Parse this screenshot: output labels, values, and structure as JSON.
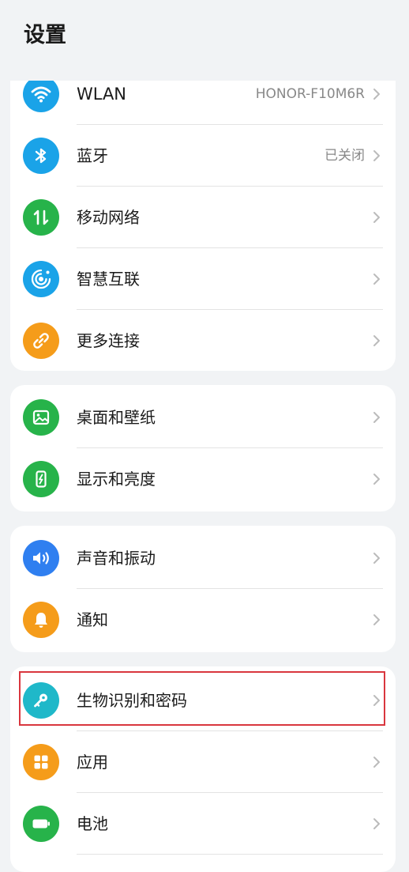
{
  "header": {
    "title": "设置"
  },
  "colors": {
    "highlight": "#d9363e",
    "wlan_icon": "#1aa3e8",
    "bluetooth_icon": "#1aa3e8",
    "mobile_icon": "#27b34a",
    "smart_icon": "#1aa3e8",
    "more_icon": "#f59c1a",
    "wallpaper_icon": "#27b34a",
    "display_icon": "#27b34a",
    "sound_icon": "#2f7ff0",
    "notify_icon": "#f59c1a",
    "biometric_icon": "#1fb8c9",
    "apps_icon": "#f59c1a",
    "battery_icon": "#27b34a"
  },
  "groups": {
    "connectivity": {
      "wlan": {
        "label": "WLAN",
        "value": "HONOR-F10M6R",
        "icon": "wifi-icon"
      },
      "bluetooth": {
        "label": "蓝牙",
        "value": "已关闭",
        "icon": "bluetooth-icon"
      },
      "mobile": {
        "label": "移动网络",
        "icon": "mobile-data-icon"
      },
      "smart": {
        "label": "智慧互联",
        "icon": "smart-connect-icon"
      },
      "more": {
        "label": "更多连接",
        "icon": "link-icon"
      }
    },
    "display": {
      "wallpaper": {
        "label": "桌面和壁纸",
        "icon": "image-icon"
      },
      "brightness": {
        "label": "显示和亮度",
        "icon": "brightness-icon"
      }
    },
    "sound": {
      "sound": {
        "label": "声音和振动",
        "icon": "speaker-icon"
      },
      "notify": {
        "label": "通知",
        "icon": "bell-icon"
      }
    },
    "security": {
      "biometric": {
        "label": "生物识别和密码",
        "icon": "key-icon"
      },
      "apps": {
        "label": "应用",
        "icon": "apps-grid-icon"
      },
      "battery": {
        "label": "电池",
        "icon": "battery-icon"
      }
    }
  }
}
